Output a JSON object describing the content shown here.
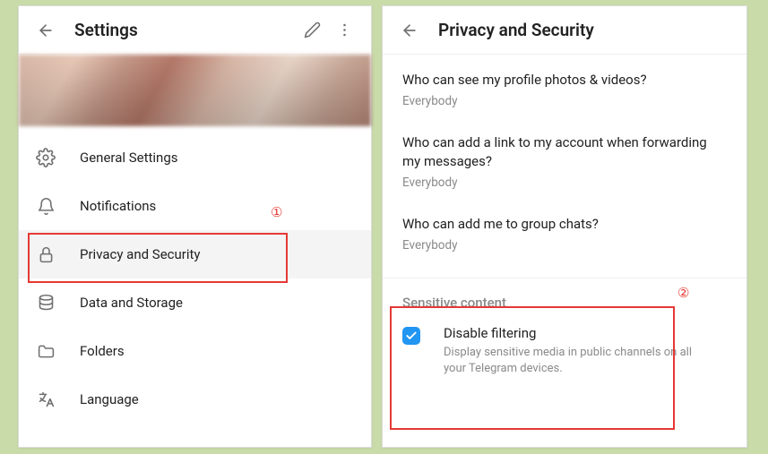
{
  "left": {
    "title": "Settings",
    "menu": [
      {
        "label": "General Settings"
      },
      {
        "label": "Notifications"
      },
      {
        "label": "Privacy and Security"
      },
      {
        "label": "Data and Storage"
      },
      {
        "label": "Folders"
      },
      {
        "label": "Language"
      }
    ]
  },
  "right": {
    "title": "Privacy and Security",
    "privacy_items": [
      {
        "question": "Who can see my profile photos & videos?",
        "value": "Everybody"
      },
      {
        "question": "Who can add a link to my account when forwarding my messages?",
        "value": "Everybody"
      },
      {
        "question": "Who can add me to group chats?",
        "value": "Everybody"
      }
    ],
    "sensitive": {
      "section_title": "Sensitive content",
      "checkbox_title": "Disable filtering",
      "checkbox_desc": "Display sensitive media in public channels on all your Telegram devices."
    }
  },
  "annotations": {
    "one": "①",
    "two": "②"
  }
}
